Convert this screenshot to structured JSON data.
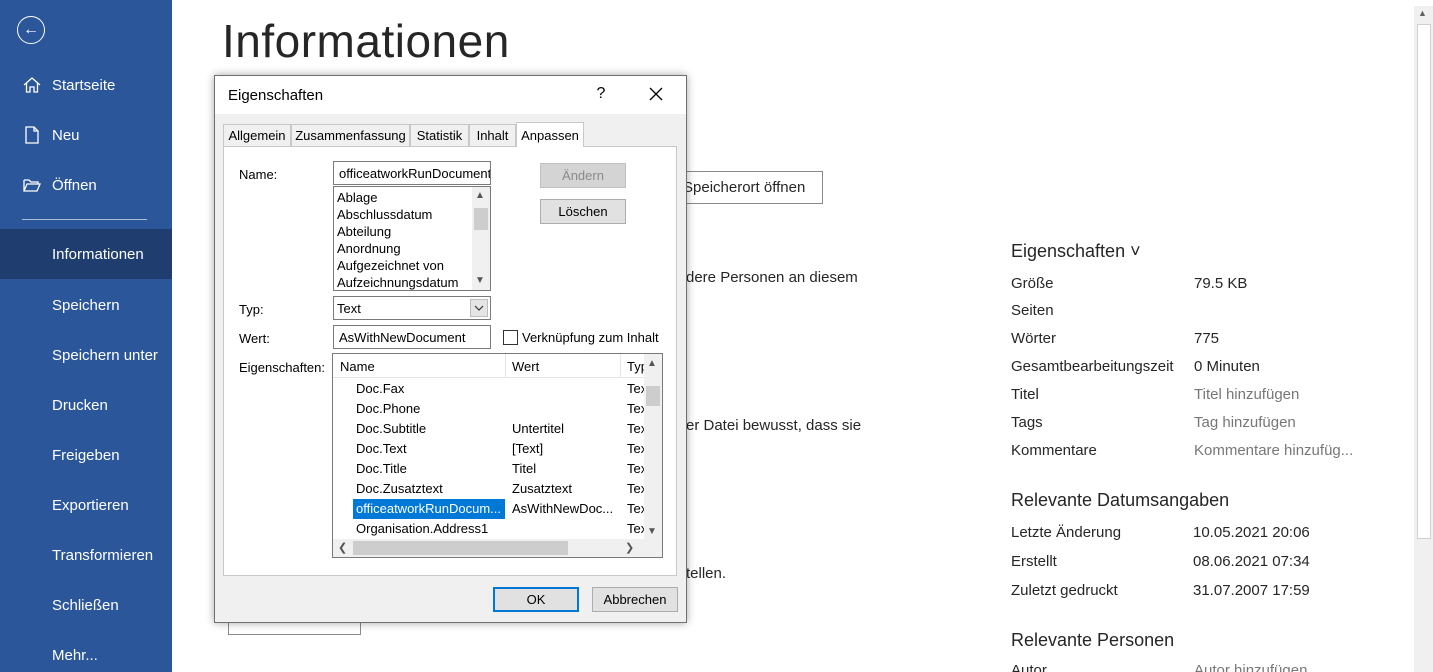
{
  "sidebar": {
    "items": [
      {
        "label": "Startseite",
        "icon": "home-icon"
      },
      {
        "label": "Neu",
        "icon": "new-document-icon"
      },
      {
        "label": "Öffnen",
        "icon": "folder-open-icon"
      },
      {
        "label": "Informationen"
      },
      {
        "label": "Speichern"
      },
      {
        "label": "Speichern unter"
      },
      {
        "label": "Drucken"
      },
      {
        "label": "Freigeben"
      },
      {
        "label": "Exportieren"
      },
      {
        "label": "Transformieren"
      },
      {
        "label": "Schließen"
      },
      {
        "label": "Mehr..."
      }
    ],
    "active": "Informationen"
  },
  "main": {
    "title": "Informationen",
    "open_location_button": "Speicherort öffnen",
    "text_fragments": [
      "dere Personen an diesem",
      "er Datei bewusst, dass sie",
      "tellen."
    ]
  },
  "properties_panel": {
    "heading": "Eigenschaften ˅",
    "rows": [
      {
        "label": "Größe",
        "value": "79.5 KB"
      },
      {
        "label": "Seiten",
        "value": ""
      },
      {
        "label": "Wörter",
        "value": "775"
      },
      {
        "label": "Gesamtbearbeitungszeit",
        "value": "0 Minuten"
      },
      {
        "label": "Titel",
        "value": "Titel hinzufügen"
      },
      {
        "label": "Tags",
        "value": "Tag hinzufügen"
      },
      {
        "label": "Kommentare",
        "value": "Kommentare hinzufüg..."
      }
    ],
    "dates_heading": "Relevante Datumsangaben",
    "dates": [
      {
        "label": "Letzte Änderung",
        "value": "10.05.2021 20:06"
      },
      {
        "label": "Erstellt",
        "value": "08.06.2021 07:34"
      },
      {
        "label": "Zuletzt gedruckt",
        "value": "31.07.2007 17:59"
      }
    ],
    "people_heading": "Relevante Personen",
    "people_first_label": "Autor",
    "people_first_value": "Autor hinzufügen"
  },
  "dialog": {
    "title": "Eigenschaften",
    "help": "?",
    "tabs": [
      "Allgemein",
      "Zusammenfassung",
      "Statistik",
      "Inhalt",
      "Anpassen"
    ],
    "selected_tab": "Anpassen",
    "name_label": "Name:",
    "name_value": "officeatworkRunDocument",
    "name_list": [
      "Ablage",
      "Abschlussdatum",
      "Abteilung",
      "Anordnung",
      "Aufgezeichnet von",
      "Aufzeichnungsdatum"
    ],
    "type_label": "Typ:",
    "type_value": "Text",
    "value_label": "Wert:",
    "value_value": "AsWithNewDocument",
    "link_checkbox_label": "Verknüpfung zum Inhalt",
    "link_checked": false,
    "properties_label": "Eigenschaften:",
    "modify_button": "Ändern",
    "delete_button": "Löschen",
    "grid_headers": [
      "Name",
      "Wert",
      "Typ"
    ],
    "grid_rows": [
      {
        "name": "Doc.Fax",
        "value": "",
        "type": "Text"
      },
      {
        "name": "Doc.Phone",
        "value": "",
        "type": "Text"
      },
      {
        "name": "Doc.Subtitle",
        "value": "Untertitel",
        "type": "Text"
      },
      {
        "name": "Doc.Text",
        "value": "[Text]",
        "type": "Text"
      },
      {
        "name": "Doc.Title",
        "value": "Titel",
        "type": "Text"
      },
      {
        "name": "Doc.Zusatztext",
        "value": "Zusatztext",
        "type": "Text"
      },
      {
        "name": "officeatworkRunDocum...",
        "value": "AsWithNewDoc...",
        "type": "Text"
      },
      {
        "name": "Organisation.Address1",
        "value": "",
        "type": "Text"
      }
    ],
    "selected_row": 6,
    "ok_button": "OK",
    "cancel_button": "Abbrechen"
  }
}
